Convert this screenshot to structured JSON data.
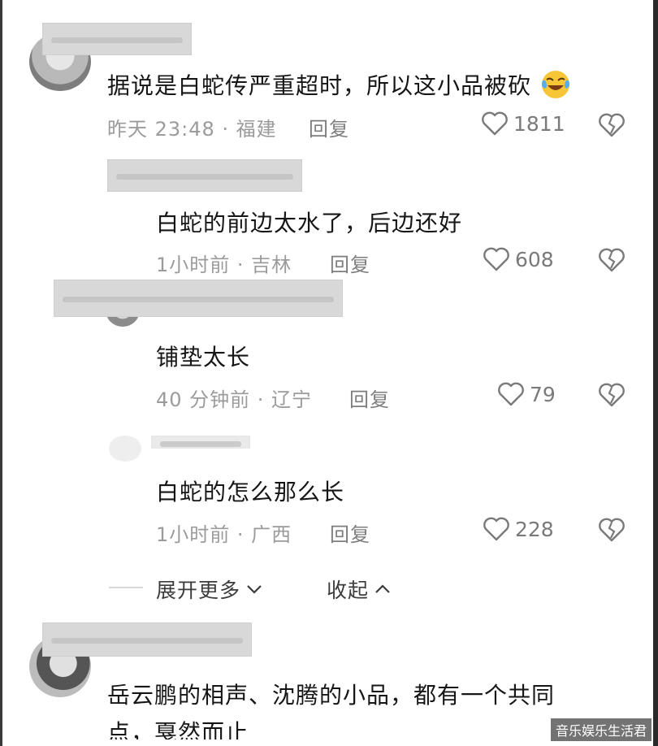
{
  "comments": [
    {
      "text": "据说是白蛇传严重超时，所以这小品被砍",
      "time": "昨天 23:48 · 福建",
      "reply_label": "回复",
      "likes": "1811",
      "emoji": "laughing-crying-emoji"
    },
    {
      "text": "白蛇的前边太水了，后边还好",
      "time": "1小时前 · 吉林",
      "reply_label": "回复",
      "likes": "608"
    },
    {
      "text": "铺垫太长",
      "time": "40 分钟前 · 辽宁",
      "reply_label": "回复",
      "likes": "79"
    },
    {
      "text": "白蛇的怎么那么长",
      "time": "1小时前 · 广西",
      "reply_label": "回复",
      "likes": "228"
    },
    {
      "text": "岳云鹏的相声、沈腾的小品，都有一个共同",
      "text_line2": "点，戛然而止"
    }
  ],
  "thread_controls": {
    "expand_label": "展开更多",
    "collapse_label": "收起"
  },
  "watermark": "音乐娱乐生活君",
  "colors": {
    "text": "#161616",
    "meta": "#9b9b9b",
    "icon": "#7a7a7a",
    "redaction": "#d8d8d8"
  }
}
